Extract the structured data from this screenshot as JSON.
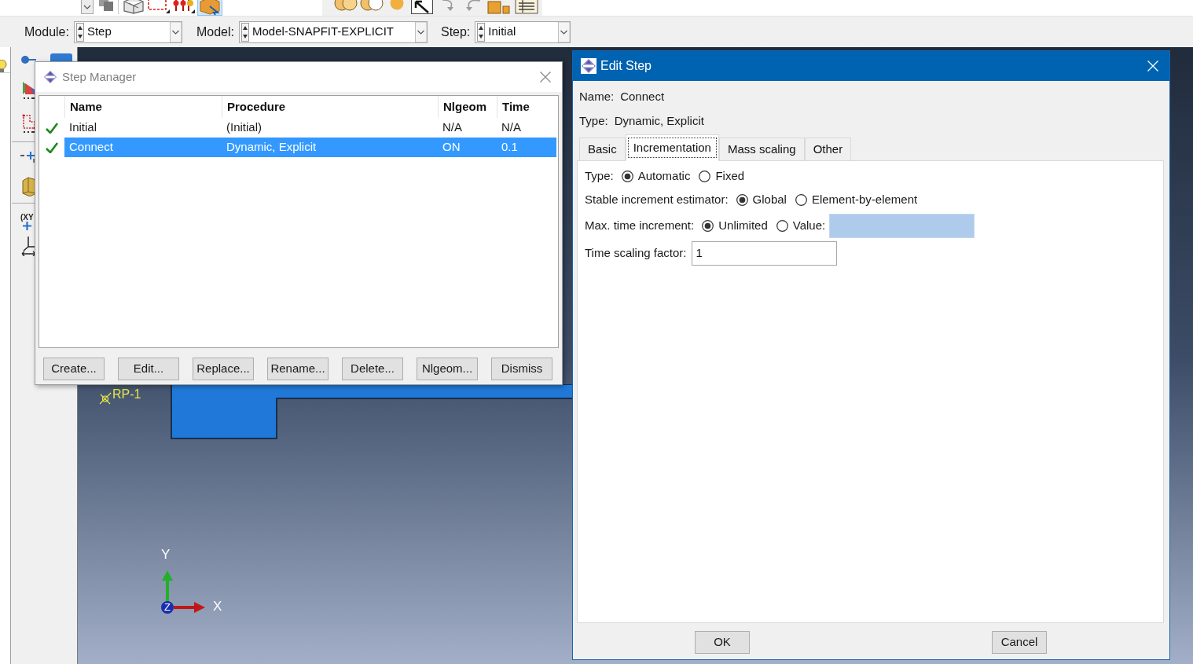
{
  "context_bar": {
    "fields": [
      {
        "label": "Module:",
        "value": "Step"
      },
      {
        "label": "Model:",
        "value": "Model-SNAPFIT-EXPLICIT"
      },
      {
        "label": "Step:",
        "value": "Initial"
      }
    ]
  },
  "toolbox": {
    "plot_label": "(XY"
  },
  "viewport": {
    "reference_point": "RP-1",
    "triad": {
      "y": "Y",
      "z": "Z",
      "x": "X"
    }
  },
  "step_manager": {
    "title": "Step Manager",
    "active": false,
    "columns": [
      "Name",
      "Procedure",
      "Nlgeom",
      "Time"
    ],
    "rows": [
      {
        "checked": true,
        "selected": false,
        "cells": [
          "Initial",
          "(Initial)",
          "N/A",
          "N/A"
        ]
      },
      {
        "checked": true,
        "selected": true,
        "cells": [
          "Connect",
          "Dynamic, Explicit",
          "ON",
          "0.1"
        ]
      }
    ],
    "buttons": [
      "Create...",
      "Edit...",
      "Replace...",
      "Rename...",
      "Delete...",
      "Nlgeom...",
      "Dismiss"
    ]
  },
  "edit_step": {
    "title": "Edit Step",
    "active": true,
    "info": [
      {
        "label": "Name:",
        "value": "Connect"
      },
      {
        "label": "Type:",
        "value": "Dynamic, Explicit"
      }
    ],
    "tabs": [
      {
        "label": "Basic",
        "selected": false
      },
      {
        "label": "Incrementation",
        "selected": true
      },
      {
        "label": "Mass scaling",
        "selected": false
      },
      {
        "label": "Other",
        "selected": false
      }
    ],
    "rows": [
      {
        "kind": "choice",
        "label": "Type:",
        "options": [
          {
            "label": "Automatic",
            "selected": true
          },
          {
            "label": "Fixed",
            "selected": false
          }
        ]
      },
      {
        "kind": "choice",
        "label": "Stable increment estimator:",
        "options": [
          {
            "label": "Global",
            "selected": true
          },
          {
            "label": "Element-by-element",
            "selected": false
          }
        ]
      },
      {
        "kind": "choice",
        "label": "Max. time increment:",
        "options": [
          {
            "label": "Unlimited",
            "selected": true
          },
          {
            "label": "Value:",
            "selected": false
          }
        ],
        "field": {
          "disabled": true
        }
      },
      {
        "kind": "field",
        "label": "Time scaling factor:",
        "field": {
          "value": "1",
          "disabled": false
        }
      }
    ],
    "buttons": [
      "OK",
      "Cancel"
    ]
  }
}
